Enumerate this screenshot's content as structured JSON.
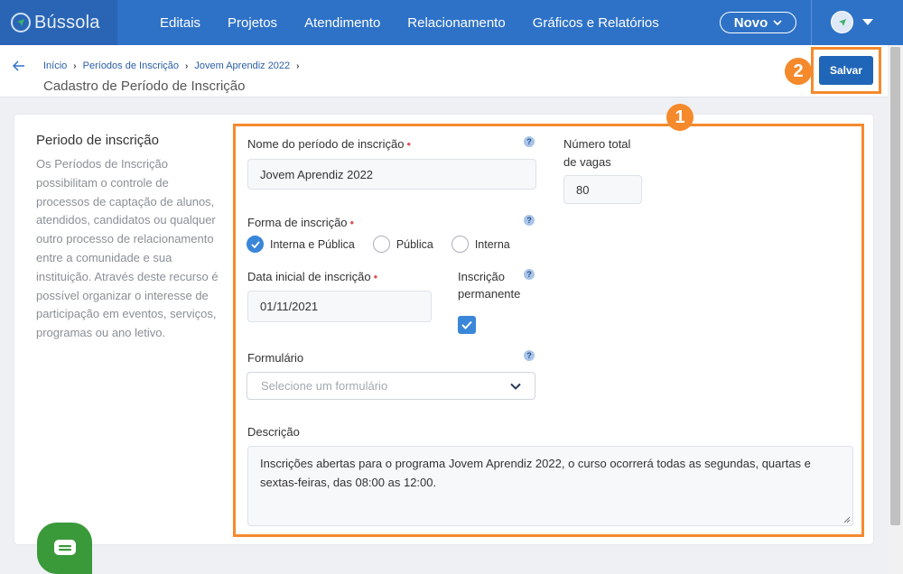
{
  "nav": {
    "brand": "Bússola",
    "items": [
      "Editais",
      "Projetos",
      "Atendimento",
      "Relacionamento",
      "Gráficos e Relatórios"
    ],
    "new_button": "Novo"
  },
  "breadcrumb": [
    "Início",
    "Períodos de Inscrição",
    "Jovem Aprendiz 2022"
  ],
  "page_title": "Cadastro de Período de Inscrição",
  "save_button": "Salvar",
  "badges": {
    "form": "1",
    "save": "2"
  },
  "sidebar": {
    "title": "Periodo de inscrição",
    "description": "Os Períodos de Inscrição possibilitam o controle de processos de captação de alunos, atendidos, candidatos ou qualquer outro processo de relacionamento entre a comunidade e sua instituição. Através deste recurso é possível organizar o interesse de participação em eventos, serviços, programas ou ano letivo."
  },
  "form": {
    "name_label": "Nome do período de inscrição",
    "name_value": "Jovem Aprendiz 2022",
    "vagas_label_1": "Número total",
    "vagas_label_2": "de vagas",
    "vagas_value": "80",
    "forma_label": "Forma de inscrição",
    "forma_options": [
      "Interna e Pública",
      "Pública",
      "Interna"
    ],
    "forma_selected": "Interna e Pública",
    "data_label": "Data inicial de inscrição",
    "data_value": "01/11/2021",
    "permanente_label_1": "Inscrição",
    "permanente_label_2": "permanente",
    "permanente_checked": true,
    "formulario_label": "Formulário",
    "formulario_placeholder": "Selecione um formulário",
    "descricao_label": "Descrição",
    "descricao_value": "Inscrições abertas para o programa Jovem Aprendiz 2022, o curso ocorrerá todas as segundas, quartas e sextas-feiras, das 08:00 as 12:00.",
    "help_glyph": "?"
  },
  "colors": {
    "nav": "#2e72c8",
    "accent": "#3a86d8",
    "highlight": "#f58a2c",
    "chat": "#3a9a3a"
  }
}
